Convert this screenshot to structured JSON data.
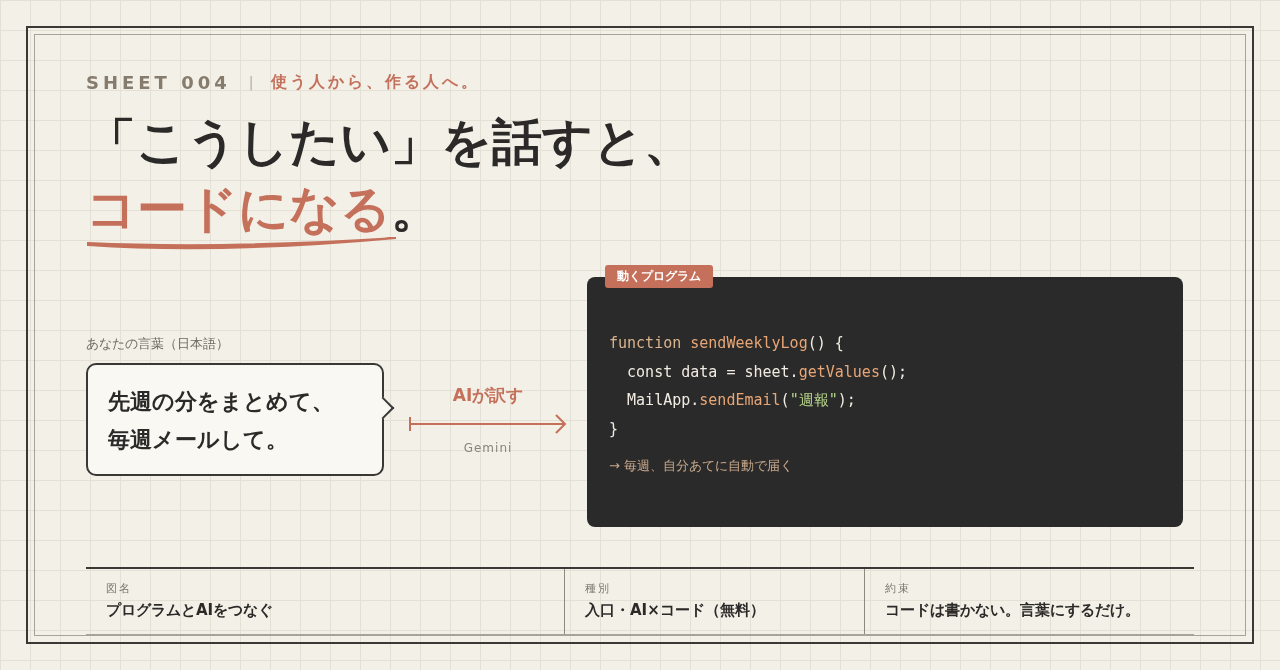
{
  "header": {
    "sheet": "SHEET 004",
    "separator": "|",
    "tagline": "使う人から、作る人へ。"
  },
  "title": {
    "line1": "「こうしたい」を話すと、",
    "highlight": "コードになる",
    "end": "。"
  },
  "input": {
    "label": "あなたの言葉（日本語）",
    "lines": [
      "先週の分をまとめて、",
      "毎週メールして。"
    ]
  },
  "translate": {
    "label": "AIが訳す",
    "engine": "Gemini"
  },
  "program": {
    "badge": "動くプログラム",
    "lines": [
      {
        "tokens": [
          {
            "kind": "keyword",
            "text": "function "
          },
          {
            "kind": "call",
            "text": "sendWeeklyLog"
          },
          {
            "kind": "plain",
            "text": "() {"
          }
        ]
      },
      {
        "tokens": [
          {
            "kind": "plain",
            "text": "  const data = sheet."
          },
          {
            "kind": "call",
            "text": "getValues"
          },
          {
            "kind": "plain",
            "text": "();"
          }
        ]
      },
      {
        "tokens": [
          {
            "kind": "plain",
            "text": "  MailApp."
          },
          {
            "kind": "call",
            "text": "sendEmail"
          },
          {
            "kind": "plain",
            "text": "("
          },
          {
            "kind": "string",
            "text": "\"週報\""
          },
          {
            "kind": "plain",
            "text": ");"
          }
        ]
      },
      {
        "tokens": [
          {
            "kind": "plain",
            "text": "}"
          }
        ]
      }
    ],
    "note": "→ 毎週、自分あてに自動で届く"
  },
  "footer": [
    {
      "label": "図名",
      "value": "プログラムとAIをつなぐ"
    },
    {
      "label": "種別",
      "value": "入口・AI×コード（無料）"
    },
    {
      "label": "約束",
      "value": "コードは書かない。言葉にするだけ。"
    }
  ]
}
